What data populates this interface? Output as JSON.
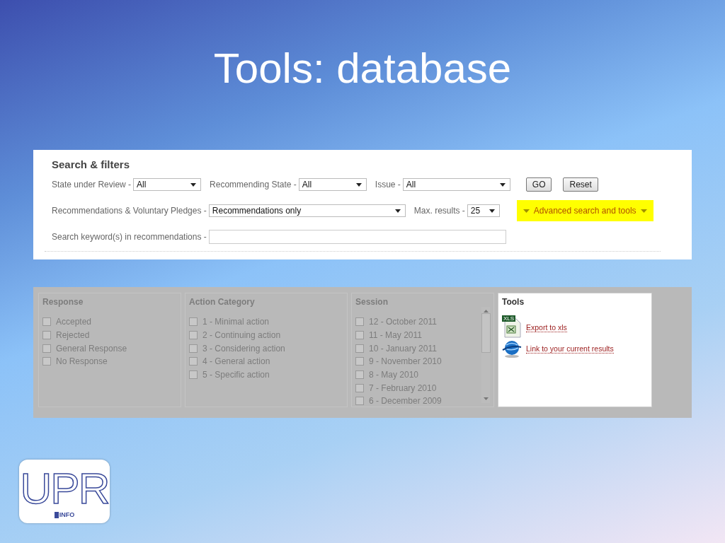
{
  "slide_title": "Tools: database",
  "search_panel": {
    "heading": "Search & filters",
    "rows": [
      {
        "items": [
          {
            "kind": "select",
            "label": "State under Review -",
            "value": "All"
          },
          {
            "kind": "select",
            "label": "Recommending State -",
            "value": "All"
          },
          {
            "kind": "select",
            "label": "Issue -",
            "value": "All"
          },
          {
            "kind": "button",
            "label": "GO"
          },
          {
            "kind": "button",
            "label": "Reset"
          }
        ]
      },
      {
        "items": [
          {
            "kind": "select",
            "label": "Recommendations & Voluntary Pledges -",
            "value": "Recommendations only"
          },
          {
            "kind": "select",
            "label": "Max. results -",
            "value": "25"
          },
          {
            "kind": "toggle",
            "label": "Advanced search and tools"
          }
        ]
      },
      {
        "items": [
          {
            "kind": "text",
            "label": "Search keyword(s) in recommendations -"
          }
        ]
      }
    ]
  },
  "advanced_panel": {
    "groups": [
      {
        "title": "Response",
        "highlighted": false,
        "scrollable": false,
        "options": [
          {
            "label": "Accepted",
            "checked": false
          },
          {
            "label": "Rejected",
            "checked": false
          },
          {
            "label": "General Response",
            "checked": false
          },
          {
            "label": "No Response",
            "checked": false
          }
        ]
      },
      {
        "title": "Action Category",
        "highlighted": false,
        "scrollable": false,
        "options": [
          {
            "label": "1 - Minimal action",
            "checked": false
          },
          {
            "label": "2 - Continuing action",
            "checked": false
          },
          {
            "label": "3 - Considering action",
            "checked": false
          },
          {
            "label": "4 - General action",
            "checked": false
          },
          {
            "label": "5 - Specific action",
            "checked": false
          }
        ]
      },
      {
        "title": "Session",
        "highlighted": false,
        "scrollable": true,
        "options": [
          {
            "label": "12 - October 2011",
            "checked": false
          },
          {
            "label": "11 - May 2011",
            "checked": false
          },
          {
            "label": "10 - January 2011",
            "checked": false
          },
          {
            "label": "9 - November 2010",
            "checked": false
          },
          {
            "label": "8 - May 2010",
            "checked": false
          },
          {
            "label": "7 - February 2010",
            "checked": false
          },
          {
            "label": "6 - December 2009",
            "checked": false
          }
        ]
      },
      {
        "title": "Tools",
        "highlighted": true,
        "links": [
          {
            "kind": "xls",
            "label": "Export to xls",
            "badge": "XLS"
          },
          {
            "kind": "globe",
            "label": "Link to your current results"
          }
        ]
      }
    ]
  },
  "logo": {
    "letters": "UPR",
    "sub": "INFO"
  }
}
